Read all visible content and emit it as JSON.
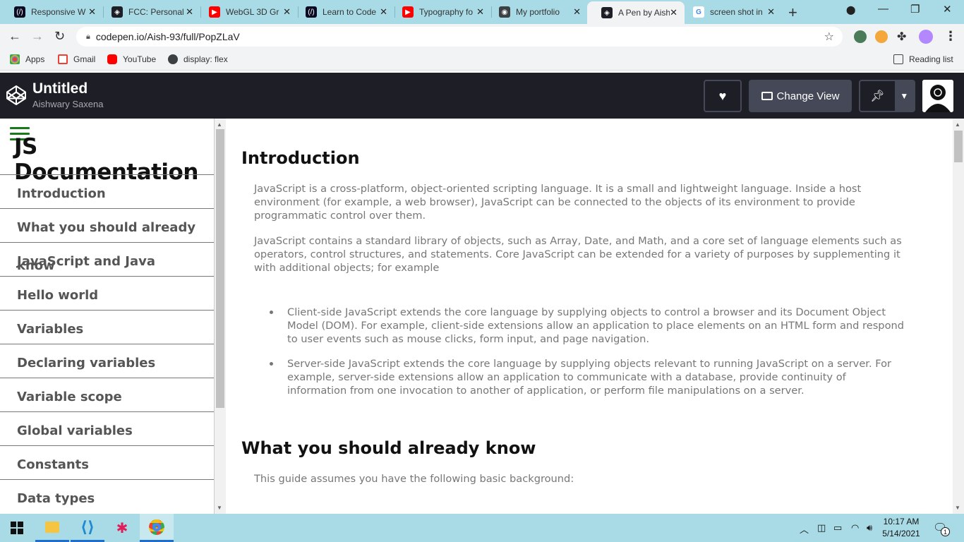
{
  "browser": {
    "tabs": [
      {
        "title": "Responsive W",
        "favicon": "freecodecamp-icon"
      },
      {
        "title": "FCC: Personal",
        "favicon": "codepen-icon"
      },
      {
        "title": "WebGL 3D Gr",
        "favicon": "youtube-icon"
      },
      {
        "title": "Learn to Code",
        "favicon": "freecodecamp-icon"
      },
      {
        "title": "Typography fo",
        "favicon": "youtube-icon"
      },
      {
        "title": "My portfolio",
        "favicon": "globe-icon"
      },
      {
        "title": "A Pen by Aish",
        "favicon": "codepen-icon",
        "active": true
      },
      {
        "title": "screen shot in",
        "favicon": "google-icon"
      }
    ],
    "url": "codepen.io/Aish-93/full/PopZLaV",
    "bookmarks": {
      "apps": "Apps",
      "gmail": "Gmail",
      "youtube": "YouTube",
      "flex": "display: flex",
      "reading_list": "Reading list"
    }
  },
  "codepen": {
    "title": "Untitled",
    "author": "Aishwary Saxena",
    "change_view_label": "Change View"
  },
  "page": {
    "nav_heading": "JS Documentation",
    "nav_links": [
      "Introduction",
      "What you should already know",
      "JavaScript and Java",
      "Hello world",
      "Variables",
      "Declaring variables",
      "Variable scope",
      "Global variables",
      "Constants",
      "Data types"
    ],
    "sections": [
      {
        "heading": "Introduction",
        "paragraphs": [
          "JavaScript is a cross-platform, object-oriented scripting language. It is a small and lightweight language. Inside a host environment (for example, a web browser), JavaScript can be connected to the objects of its environment to provide programmatic control over them.",
          "JavaScript contains a standard library of objects, such as Array, Date, and Math, and a core set of language elements such as operators, control structures, and statements. Core JavaScript can be extended for a variety of purposes by supplementing it with additional objects; for example"
        ],
        "bullets": [
          "Client-side JavaScript extends the core language by supplying objects to control a browser and its Document Object Model (DOM). For example, client-side extensions allow an application to place elements on an HTML form and respond to user events such as mouse clicks, form input, and page navigation.",
          "Server-side JavaScript extends the core language by supplying objects relevant to running JavaScript on a server. For example, server-side extensions allow an application to communicate with a database, provide continuity of information from one invocation to another of application, or perform file manipulations on a server."
        ]
      },
      {
        "heading": "What you should already know",
        "paragraphs": [
          "This guide assumes you have the following basic background:"
        ]
      }
    ]
  },
  "taskbar": {
    "time": "10:17 AM",
    "date": "5/14/2021",
    "notification_count": "1"
  },
  "colors": {
    "chrome_frame": "#a9dbe6",
    "codepen_header": "#1e1f26",
    "hamburger": "#1a7a1a",
    "body_text": "#777777"
  }
}
